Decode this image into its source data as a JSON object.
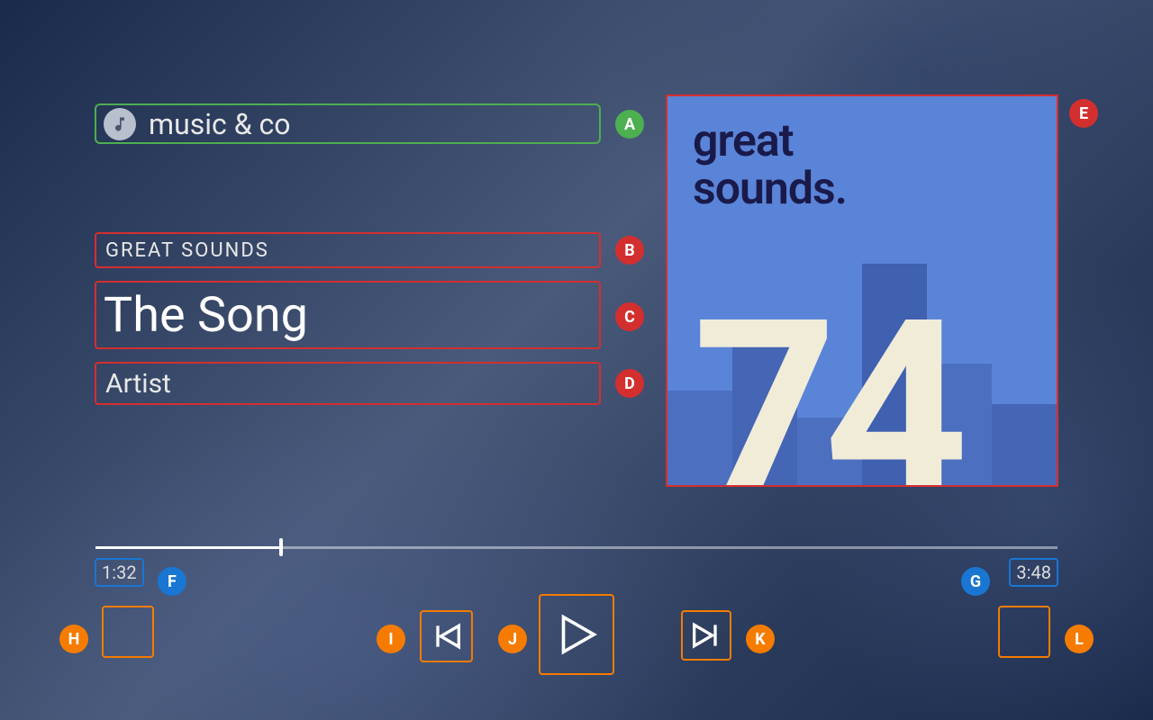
{
  "header": {
    "app_name": "music & co"
  },
  "now_playing": {
    "album": "Great Sounds",
    "song": "The Song",
    "artist": "Artist"
  },
  "album_art": {
    "line1": "great",
    "line2": "sounds.",
    "number": "74"
  },
  "progress": {
    "current": "1:32",
    "total": "3:48",
    "percent": 19.3
  },
  "markers": {
    "A": "A",
    "B": "B",
    "C": "C",
    "D": "D",
    "E": "E",
    "F": "F",
    "G": "G",
    "H": "H",
    "I": "I",
    "J": "J",
    "K": "K",
    "L": "L"
  }
}
